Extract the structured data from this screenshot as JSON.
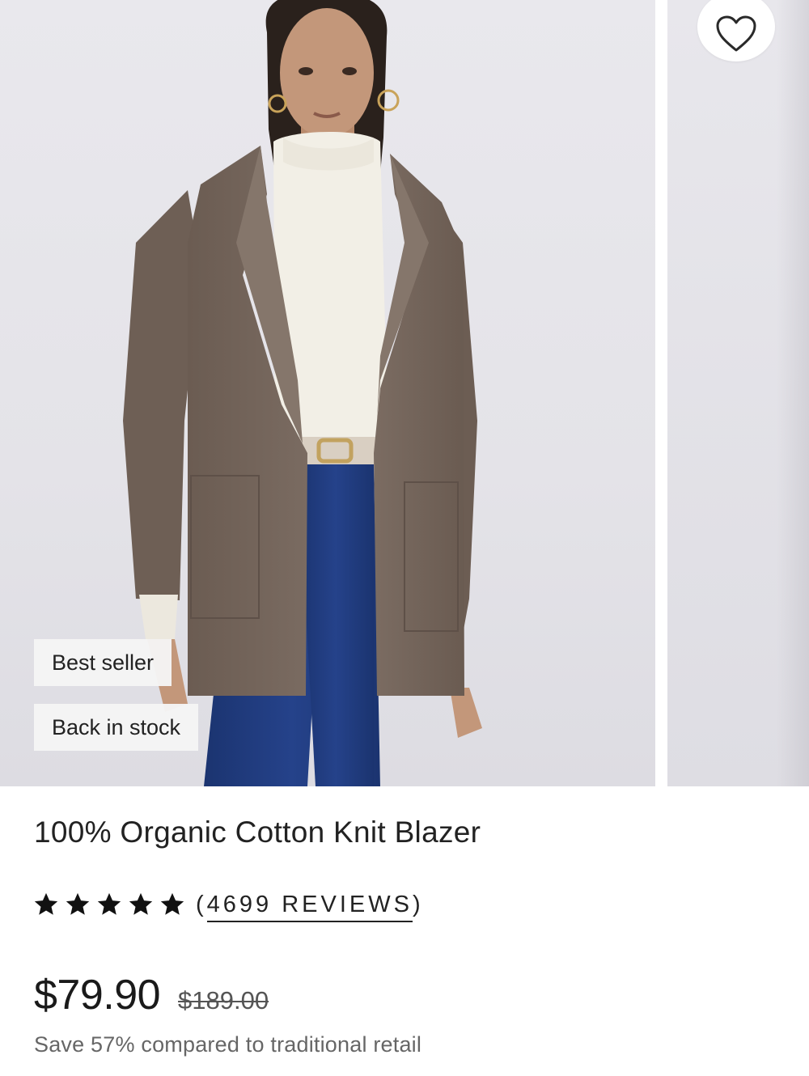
{
  "product": {
    "title": "100% Organic Cotton Knit Blazer",
    "badges": [
      "Best seller",
      "Back in stock"
    ],
    "rating": {
      "stars": 5,
      "open_paren": "(",
      "count_label": "4699 REVIEWS",
      "close_paren": ")"
    },
    "price": "$79.90",
    "compare_price": "$189.00",
    "savings_text": "Save 57% compared to traditional retail"
  },
  "icons": {
    "favorite": "heart-outline-icon",
    "rating": "star-filled-icon"
  },
  "colors": {
    "photo_background": "#e6e5ea",
    "blazer": "#76675d",
    "turtleneck": "#f2efe6",
    "jeans": "#1f3a78",
    "text": "#1a1a1a",
    "muted_text": "#666666"
  }
}
